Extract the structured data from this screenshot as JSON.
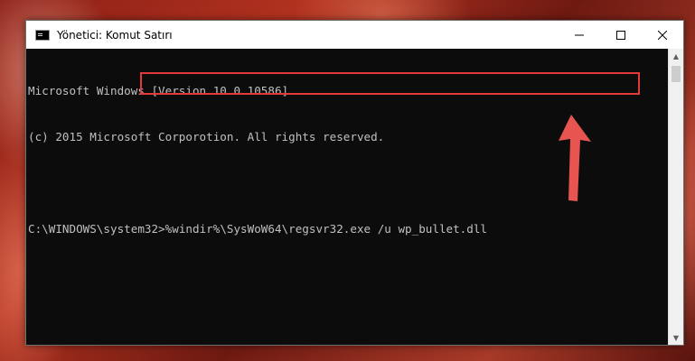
{
  "window": {
    "title": "Yönetici: Komut Satırı",
    "controls": [
      "minimize",
      "maximize",
      "close"
    ]
  },
  "console": {
    "lines": [
      "Microsoft Windows [Version 10.0.10586]",
      "(c) 2015 Microsoft Corporotion. All rights reserved."
    ],
    "prompt": "C:\\WINDOWS\\system32>",
    "command": "%windir%\\SysWoW64\\regsvr32.exe /u wp_bullet.dll"
  },
  "annotation": {
    "highlight_color": "#e23a3a",
    "arrow_color": "#e8544f"
  }
}
